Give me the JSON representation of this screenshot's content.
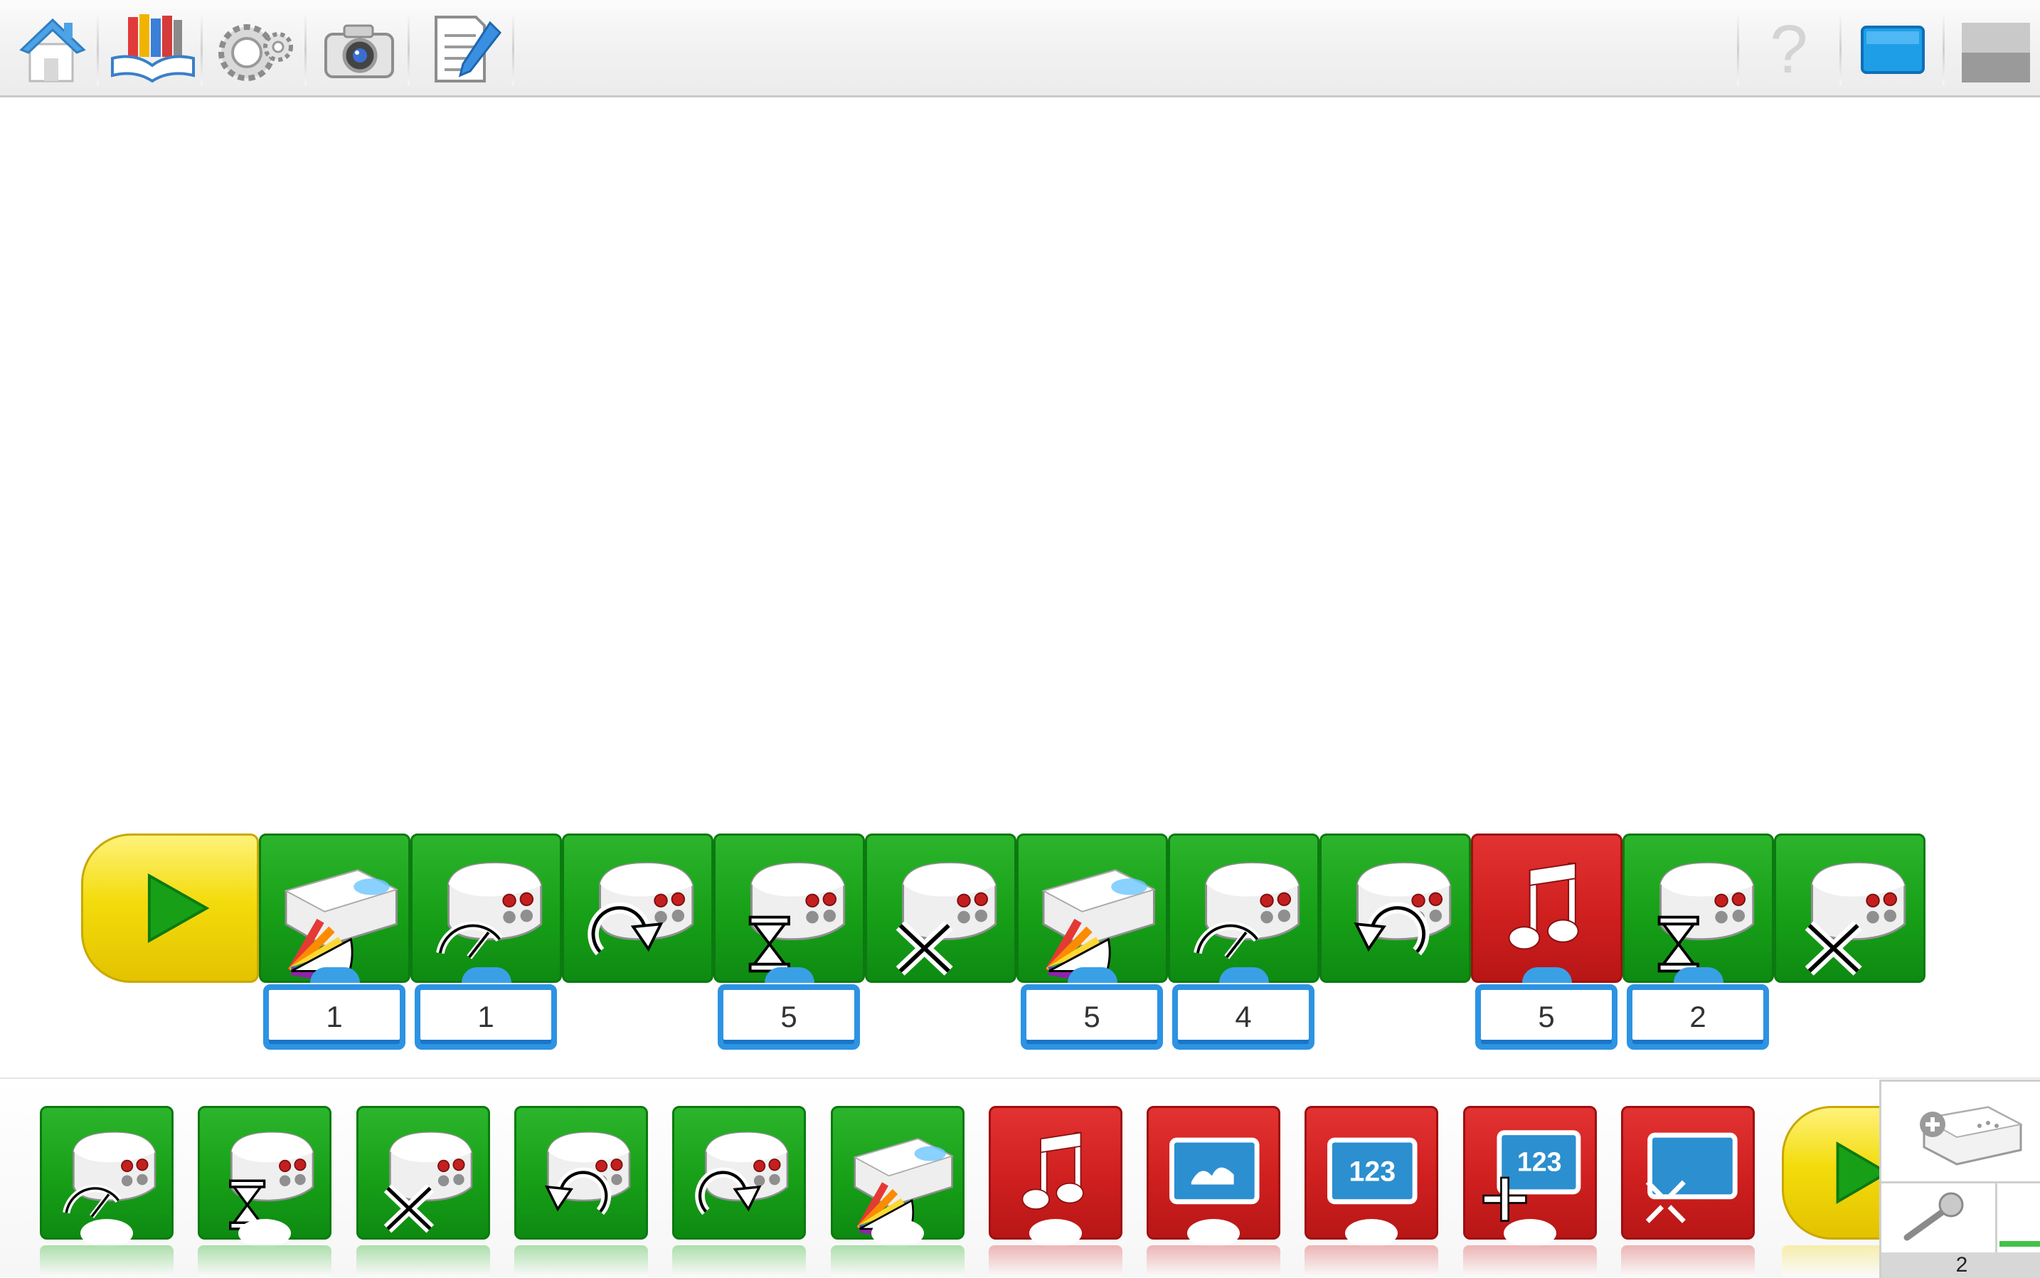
{
  "toolbar": {
    "left_buttons": [
      {
        "name": "home-button",
        "icon": "house-icon"
      },
      {
        "name": "library-button",
        "icon": "books-icon"
      },
      {
        "name": "gears-button",
        "icon": "gears-icon"
      },
      {
        "name": "camera-button",
        "icon": "camera-icon"
      },
      {
        "name": "notes-button",
        "icon": "document-pencil-icon"
      }
    ],
    "right_buttons": [
      {
        "name": "help-button",
        "icon": "question-icon",
        "glyph": "?"
      },
      {
        "name": "screen-button",
        "icon": "blue-screen-icon"
      },
      {
        "name": "panel-toggle-button",
        "icon": "gray-panel-icon"
      }
    ]
  },
  "program": {
    "start_block": {
      "icon": "play-icon"
    },
    "blocks": [
      {
        "kind": "hub-light-color",
        "color": "green",
        "param": "1"
      },
      {
        "kind": "motor-power",
        "color": "green",
        "param": "1"
      },
      {
        "kind": "motor-clockwise",
        "color": "green",
        "param": ""
      },
      {
        "kind": "motor-on-for",
        "color": "green",
        "param": "5"
      },
      {
        "kind": "motor-off",
        "color": "green",
        "param": ""
      },
      {
        "kind": "hub-light-color",
        "color": "green",
        "param": "5"
      },
      {
        "kind": "motor-power",
        "color": "green",
        "param": "4"
      },
      {
        "kind": "motor-counterclockwise",
        "color": "green",
        "param": ""
      },
      {
        "kind": "play-sound",
        "color": "red",
        "param": "5"
      },
      {
        "kind": "motor-on-for",
        "color": "green",
        "param": "2"
      },
      {
        "kind": "motor-off",
        "color": "green",
        "param": ""
      }
    ]
  },
  "palette": {
    "blocks": [
      {
        "kind": "motor-power",
        "color": "green"
      },
      {
        "kind": "motor-on-for",
        "color": "green"
      },
      {
        "kind": "motor-off",
        "color": "green"
      },
      {
        "kind": "motor-counterclockwise",
        "color": "green"
      },
      {
        "kind": "motor-clockwise",
        "color": "green"
      },
      {
        "kind": "hub-light-color",
        "color": "green"
      },
      {
        "kind": "play-sound",
        "color": "red"
      },
      {
        "kind": "display-background",
        "color": "red"
      },
      {
        "kind": "display-text",
        "color": "red",
        "glyph": "123"
      },
      {
        "kind": "display-add",
        "color": "red",
        "glyph": "123"
      },
      {
        "kind": "display-minimize",
        "color": "red"
      }
    ],
    "partial_start_block": {
      "icon": "play-icon"
    }
  },
  "device_panel": {
    "hub_icon": "hub-add-icon",
    "mic_icon": "microphone-icon",
    "count": "2"
  },
  "colors": {
    "block_green": "#17a017",
    "block_red": "#cf1f1f",
    "start_yellow": "#f3dc0c",
    "param_blue": "#2d93e3"
  }
}
